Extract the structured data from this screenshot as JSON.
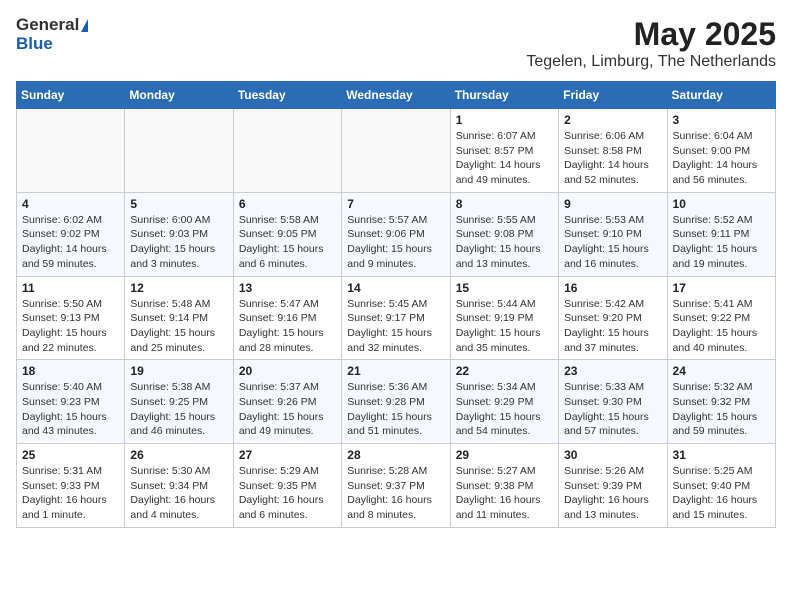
{
  "header": {
    "logo_general": "General",
    "logo_blue": "Blue",
    "title": "May 2025",
    "subtitle": "Tegelen, Limburg, The Netherlands"
  },
  "days_of_week": [
    "Sunday",
    "Monday",
    "Tuesday",
    "Wednesday",
    "Thursday",
    "Friday",
    "Saturday"
  ],
  "weeks": [
    [
      {
        "day": "",
        "info": ""
      },
      {
        "day": "",
        "info": ""
      },
      {
        "day": "",
        "info": ""
      },
      {
        "day": "",
        "info": ""
      },
      {
        "day": "1",
        "info": "Sunrise: 6:07 AM\nSunset: 8:57 PM\nDaylight: 14 hours\nand 49 minutes."
      },
      {
        "day": "2",
        "info": "Sunrise: 6:06 AM\nSunset: 8:58 PM\nDaylight: 14 hours\nand 52 minutes."
      },
      {
        "day": "3",
        "info": "Sunrise: 6:04 AM\nSunset: 9:00 PM\nDaylight: 14 hours\nand 56 minutes."
      }
    ],
    [
      {
        "day": "4",
        "info": "Sunrise: 6:02 AM\nSunset: 9:02 PM\nDaylight: 14 hours\nand 59 minutes."
      },
      {
        "day": "5",
        "info": "Sunrise: 6:00 AM\nSunset: 9:03 PM\nDaylight: 15 hours\nand 3 minutes."
      },
      {
        "day": "6",
        "info": "Sunrise: 5:58 AM\nSunset: 9:05 PM\nDaylight: 15 hours\nand 6 minutes."
      },
      {
        "day": "7",
        "info": "Sunrise: 5:57 AM\nSunset: 9:06 PM\nDaylight: 15 hours\nand 9 minutes."
      },
      {
        "day": "8",
        "info": "Sunrise: 5:55 AM\nSunset: 9:08 PM\nDaylight: 15 hours\nand 13 minutes."
      },
      {
        "day": "9",
        "info": "Sunrise: 5:53 AM\nSunset: 9:10 PM\nDaylight: 15 hours\nand 16 minutes."
      },
      {
        "day": "10",
        "info": "Sunrise: 5:52 AM\nSunset: 9:11 PM\nDaylight: 15 hours\nand 19 minutes."
      }
    ],
    [
      {
        "day": "11",
        "info": "Sunrise: 5:50 AM\nSunset: 9:13 PM\nDaylight: 15 hours\nand 22 minutes."
      },
      {
        "day": "12",
        "info": "Sunrise: 5:48 AM\nSunset: 9:14 PM\nDaylight: 15 hours\nand 25 minutes."
      },
      {
        "day": "13",
        "info": "Sunrise: 5:47 AM\nSunset: 9:16 PM\nDaylight: 15 hours\nand 28 minutes."
      },
      {
        "day": "14",
        "info": "Sunrise: 5:45 AM\nSunset: 9:17 PM\nDaylight: 15 hours\nand 32 minutes."
      },
      {
        "day": "15",
        "info": "Sunrise: 5:44 AM\nSunset: 9:19 PM\nDaylight: 15 hours\nand 35 minutes."
      },
      {
        "day": "16",
        "info": "Sunrise: 5:42 AM\nSunset: 9:20 PM\nDaylight: 15 hours\nand 37 minutes."
      },
      {
        "day": "17",
        "info": "Sunrise: 5:41 AM\nSunset: 9:22 PM\nDaylight: 15 hours\nand 40 minutes."
      }
    ],
    [
      {
        "day": "18",
        "info": "Sunrise: 5:40 AM\nSunset: 9:23 PM\nDaylight: 15 hours\nand 43 minutes."
      },
      {
        "day": "19",
        "info": "Sunrise: 5:38 AM\nSunset: 9:25 PM\nDaylight: 15 hours\nand 46 minutes."
      },
      {
        "day": "20",
        "info": "Sunrise: 5:37 AM\nSunset: 9:26 PM\nDaylight: 15 hours\nand 49 minutes."
      },
      {
        "day": "21",
        "info": "Sunrise: 5:36 AM\nSunset: 9:28 PM\nDaylight: 15 hours\nand 51 minutes."
      },
      {
        "day": "22",
        "info": "Sunrise: 5:34 AM\nSunset: 9:29 PM\nDaylight: 15 hours\nand 54 minutes."
      },
      {
        "day": "23",
        "info": "Sunrise: 5:33 AM\nSunset: 9:30 PM\nDaylight: 15 hours\nand 57 minutes."
      },
      {
        "day": "24",
        "info": "Sunrise: 5:32 AM\nSunset: 9:32 PM\nDaylight: 15 hours\nand 59 minutes."
      }
    ],
    [
      {
        "day": "25",
        "info": "Sunrise: 5:31 AM\nSunset: 9:33 PM\nDaylight: 16 hours\nand 1 minute."
      },
      {
        "day": "26",
        "info": "Sunrise: 5:30 AM\nSunset: 9:34 PM\nDaylight: 16 hours\nand 4 minutes."
      },
      {
        "day": "27",
        "info": "Sunrise: 5:29 AM\nSunset: 9:35 PM\nDaylight: 16 hours\nand 6 minutes."
      },
      {
        "day": "28",
        "info": "Sunrise: 5:28 AM\nSunset: 9:37 PM\nDaylight: 16 hours\nand 8 minutes."
      },
      {
        "day": "29",
        "info": "Sunrise: 5:27 AM\nSunset: 9:38 PM\nDaylight: 16 hours\nand 11 minutes."
      },
      {
        "day": "30",
        "info": "Sunrise: 5:26 AM\nSunset: 9:39 PM\nDaylight: 16 hours\nand 13 minutes."
      },
      {
        "day": "31",
        "info": "Sunrise: 5:25 AM\nSunset: 9:40 PM\nDaylight: 16 hours\nand 15 minutes."
      }
    ]
  ]
}
